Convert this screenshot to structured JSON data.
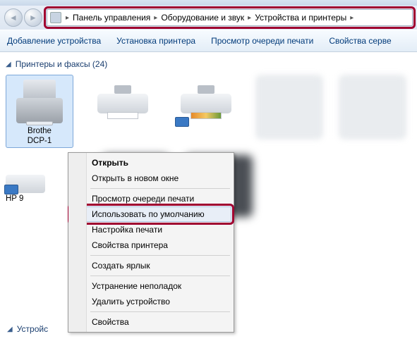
{
  "breadcrumb": {
    "seg1": "Панель управления",
    "seg2": "Оборудование и звук",
    "seg3": "Устройства и принтеры"
  },
  "toolbar": {
    "add_device": "Добавление устройства",
    "add_printer": "Установка принтера",
    "view_queue": "Просмотр очереди печати",
    "server_props": "Свойства серве"
  },
  "groups": {
    "printers_header": "Принтеры и факсы (24)",
    "devices_header": "Устройс"
  },
  "devices": {
    "selected_label_line1": "Brothe",
    "selected_label_line2": "DCP-1",
    "hp_label": "HP 9"
  },
  "context_menu": {
    "open": "Открыть",
    "open_new_window": "Открыть в новом окне",
    "view_queue": "Просмотр очереди печати",
    "set_default": "Использовать по умолчанию",
    "print_settings": "Настройка печати",
    "printer_props": "Свойства принтера",
    "create_shortcut": "Создать ярлык",
    "troubleshoot": "Устранение неполадок",
    "remove_device": "Удалить устройство",
    "properties": "Свойства"
  }
}
